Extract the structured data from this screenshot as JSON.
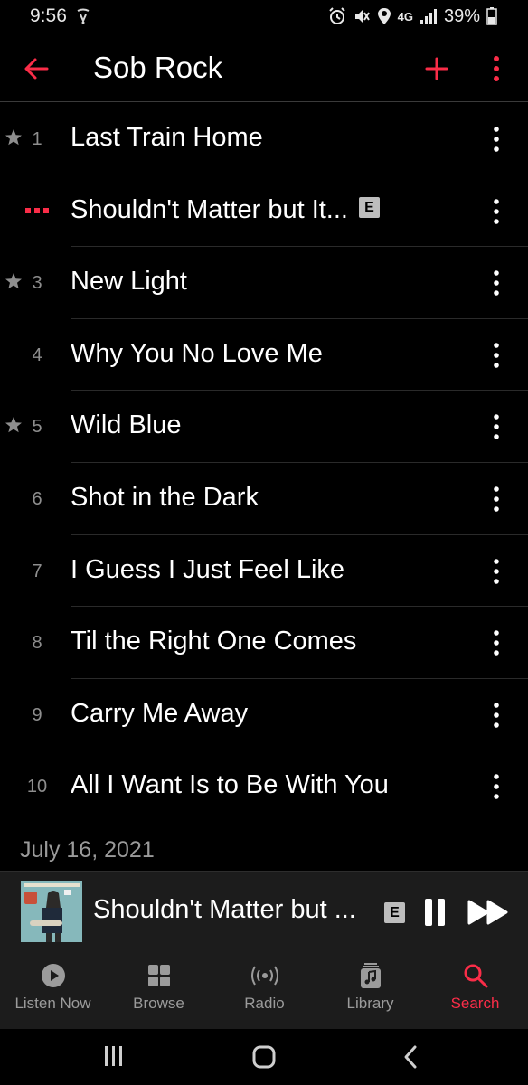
{
  "status_bar": {
    "time": "9:56",
    "network": "4G",
    "battery": "39%",
    "icons": [
      "alarm-icon",
      "mute-icon",
      "location-icon",
      "signal-icon",
      "battery-icon"
    ]
  },
  "header": {
    "title": "Sob Rock",
    "back_icon": "back-arrow-icon",
    "add_icon": "plus-icon",
    "more_icon": "more-vertical-icon"
  },
  "colors": {
    "accent": "#fa2d48",
    "background": "#000000",
    "secondary_text": "#8e8e8e",
    "surface": "#1c1c1c"
  },
  "tracks": [
    {
      "number": "1",
      "title": "Last Train Home",
      "starred": true,
      "explicit": false,
      "playing": false
    },
    {
      "number": "2",
      "title": "Shouldn't Matter but It...",
      "starred": false,
      "explicit": true,
      "playing": true
    },
    {
      "number": "3",
      "title": "New Light",
      "starred": true,
      "explicit": false,
      "playing": false
    },
    {
      "number": "4",
      "title": "Why You No Love Me",
      "starred": false,
      "explicit": false,
      "playing": false
    },
    {
      "number": "5",
      "title": "Wild Blue",
      "starred": true,
      "explicit": false,
      "playing": false
    },
    {
      "number": "6",
      "title": "Shot in the Dark",
      "starred": false,
      "explicit": false,
      "playing": false
    },
    {
      "number": "7",
      "title": "I Guess I Just Feel Like",
      "starred": false,
      "explicit": false,
      "playing": false
    },
    {
      "number": "8",
      "title": "Til the Right One Comes",
      "starred": false,
      "explicit": false,
      "playing": false
    },
    {
      "number": "9",
      "title": "Carry Me Away",
      "starred": false,
      "explicit": false,
      "playing": false
    },
    {
      "number": "10",
      "title": "All I Want Is to Be With You",
      "starred": false,
      "explicit": false,
      "playing": false
    }
  ],
  "explicit_label": "E",
  "release_date": "July 16, 2021",
  "now_playing": {
    "title": "Shouldn't Matter but ...",
    "explicit": true,
    "pause_icon": "pause-icon",
    "next_icon": "fast-forward-icon"
  },
  "tabs": [
    {
      "label": "Listen Now",
      "icon": "play-circle-icon",
      "active": false
    },
    {
      "label": "Browse",
      "icon": "grid-icon",
      "active": false
    },
    {
      "label": "Radio",
      "icon": "radio-waves-icon",
      "active": false
    },
    {
      "label": "Library",
      "icon": "music-library-icon",
      "active": false
    },
    {
      "label": "Search",
      "icon": "search-icon",
      "active": true
    }
  ],
  "system_nav": [
    "recents-icon",
    "home-icon",
    "back-icon"
  ]
}
